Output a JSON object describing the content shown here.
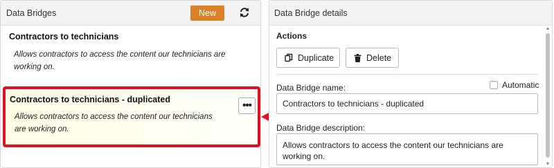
{
  "left_panel": {
    "title": "Data Bridges",
    "new_button": "New",
    "refresh_icon": "refresh-icon",
    "items": [
      {
        "name": "Contractors to technicians",
        "description": "Allows contractors to access the content our technicians are working on."
      },
      {
        "name": "Contractors to technicians - duplicated",
        "description": "Allows contractors to access the content our technicians are working on.",
        "more_button": "•••"
      }
    ]
  },
  "right_panel": {
    "title": "Data Bridge details",
    "actions_label": "Actions",
    "duplicate_button": "Duplicate",
    "delete_button": "Delete",
    "automatic_label": "Automatic",
    "name_label": "Data Bridge name:",
    "name_value": "Contractors to technicians - duplicated",
    "description_label": "Data Bridge description:",
    "description_value": "Allows contractors to access the content our technicians are working on."
  },
  "colors": {
    "new_button": "#d98227",
    "highlight_border": "#e0101f",
    "highlight_background": "#fffde6"
  }
}
